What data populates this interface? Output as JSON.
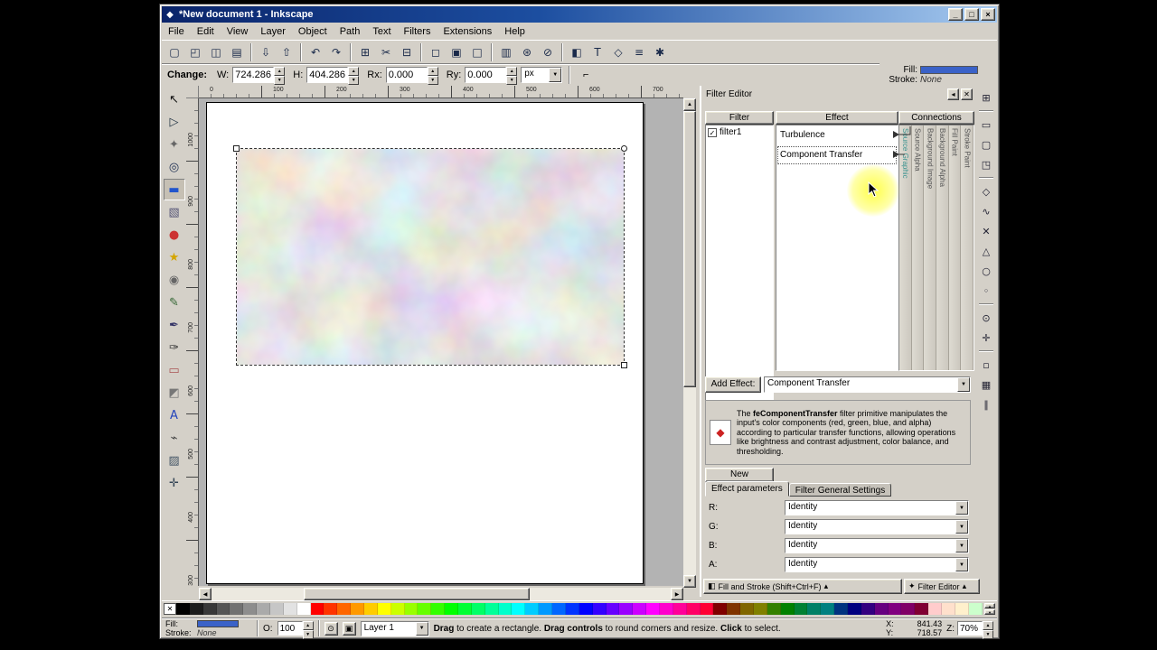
{
  "window": {
    "title": "*New document 1 - Inkscape"
  },
  "icons": {
    "window_logo": "◆",
    "window_minimize": "_",
    "window_maximize": "□",
    "window_close": "×",
    "dropdown_arrow": "▼",
    "spin_up": "▲",
    "spin_down": "▼",
    "scroll_left": "◀",
    "scroll_right": "▶",
    "scroll_up": "▲",
    "scroll_down": "▼",
    "collapse_arrow": "▴",
    "close": "✕",
    "dock_arrow": "◂",
    "check": "✓",
    "none_swatch_x": "✕",
    "corner_tool": "⌐",
    "eye": "⊙",
    "lock": "▣",
    "fill_stroke_bar_icon": "◧",
    "filter_bar_icon": "✦",
    "description_icon": "◆"
  },
  "menu": {
    "items": [
      "File",
      "Edit",
      "View",
      "Layer",
      "Object",
      "Path",
      "Text",
      "Filters",
      "Extensions",
      "Help"
    ]
  },
  "command_toolbar": {
    "buttons": [
      {
        "name": "new-document-button",
        "glyph": "▢"
      },
      {
        "name": "open-document-button",
        "glyph": "◰"
      },
      {
        "name": "save-document-button",
        "glyph": "◫"
      },
      {
        "name": "print-button",
        "glyph": "▤"
      },
      {
        "name": "separator"
      },
      {
        "name": "import-button",
        "glyph": "⇩"
      },
      {
        "name": "export-button",
        "glyph": "⇧"
      },
      {
        "name": "separator"
      },
      {
        "name": "undo-button",
        "glyph": "↶"
      },
      {
        "name": "redo-button",
        "glyph": "↷"
      },
      {
        "name": "separator"
      },
      {
        "name": "copy-button",
        "glyph": "⊞"
      },
      {
        "name": "cut-button",
        "glyph": "✂"
      },
      {
        "name": "paste-button",
        "glyph": "⊟"
      },
      {
        "name": "separator"
      },
      {
        "name": "zoom-selection-button",
        "glyph": "◻"
      },
      {
        "name": "zoom-drawing-button",
        "glyph": "▣"
      },
      {
        "name": "zoom-page-button",
        "glyph": "□"
      },
      {
        "name": "separator"
      },
      {
        "name": "duplicate-button",
        "glyph": "▥"
      },
      {
        "name": "clone-button",
        "glyph": "⊛"
      },
      {
        "name": "unlink-clone-button",
        "glyph": "⊘"
      },
      {
        "name": "separator"
      },
      {
        "name": "fill-stroke-dialog-button",
        "glyph": "◧"
      },
      {
        "name": "text-dialog-button",
        "glyph": "T"
      },
      {
        "name": "xml-editor-button",
        "glyph": "◇"
      },
      {
        "name": "align-dialog-button",
        "glyph": "≡"
      },
      {
        "name": "preferences-button",
        "glyph": "✱"
      }
    ]
  },
  "tool_options": {
    "context_label": "Change:",
    "fields": [
      {
        "label": "W:",
        "value": "724.286"
      },
      {
        "label": "H:",
        "value": "404.286"
      },
      {
        "label": "Rx:",
        "value": "0.000"
      },
      {
        "label": "Ry:",
        "value": "0.000"
      }
    ],
    "unit": "px"
  },
  "fill_indicator": {
    "fill_label": "Fill:",
    "stroke_label": "Stroke:",
    "stroke_value": "None",
    "fill_color": "#3a62c8"
  },
  "toolbox": {
    "tools": [
      {
        "name": "selector-tool",
        "glyph": "↖",
        "color": "#111111"
      },
      {
        "name": "node-tool",
        "glyph": "▷",
        "color": "#223344"
      },
      {
        "name": "tweak-tool",
        "glyph": "✦",
        "color": "#666666"
      },
      {
        "name": "zoom-tool",
        "glyph": "◎",
        "color": "#223355"
      },
      {
        "name": "rectangle-tool",
        "glyph": "▬",
        "color": "#2255cc",
        "active": true
      },
      {
        "name": "box3d-tool",
        "glyph": "▧",
        "color": "#555577"
      },
      {
        "name": "ellipse-tool",
        "glyph": "●",
        "color": "#cc3333"
      },
      {
        "name": "star-tool",
        "glyph": "★",
        "color": "#d4a500"
      },
      {
        "name": "spiral-tool",
        "glyph": "◉",
        "color": "#666666"
      },
      {
        "name": "pencil-tool",
        "glyph": "✎",
        "color": "#336633"
      },
      {
        "name": "pen-tool",
        "glyph": "✒",
        "color": "#333366"
      },
      {
        "name": "calligraphy-tool",
        "glyph": "✑",
        "color": "#333333"
      },
      {
        "name": "eraser-tool",
        "glyph": "▭",
        "color": "#aa5555"
      },
      {
        "name": "paint-bucket-tool",
        "glyph": "◩",
        "color": "#777777"
      },
      {
        "name": "text-tool",
        "glyph": "A",
        "color": "#2244bb"
      },
      {
        "name": "connector-tool",
        "glyph": "⌁",
        "color": "#444444"
      },
      {
        "name": "gradient-tool",
        "glyph": "▨",
        "color": "#445566"
      },
      {
        "name": "dropper-tool",
        "glyph": "✛",
        "color": "#334455"
      }
    ]
  },
  "snap_toolbar": {
    "buttons": [
      {
        "name": "snap-toggle-button",
        "glyph": "⊞"
      },
      {
        "name": "separator"
      },
      {
        "name": "snap-bbox-button",
        "glyph": "▭"
      },
      {
        "name": "snap-bbox-edges-button",
        "glyph": "▢"
      },
      {
        "name": "snap-bbox-corners-button",
        "glyph": "◳"
      },
      {
        "name": "separator"
      },
      {
        "name": "snap-nodes-button",
        "glyph": "◇"
      },
      {
        "name": "snap-paths-button",
        "glyph": "∿"
      },
      {
        "name": "snap-path-intersections-button",
        "glyph": "✕"
      },
      {
        "name": "snap-cusp-nodes-button",
        "glyph": "△"
      },
      {
        "name": "snap-smooth-nodes-button",
        "glyph": "○"
      },
      {
        "name": "snap-midpoints-button",
        "glyph": "◦"
      },
      {
        "name": "separator"
      },
      {
        "name": "snap-object-centers-button",
        "glyph": "⊙"
      },
      {
        "name": "snap-rotation-centers-button",
        "glyph": "✛"
      },
      {
        "name": "separator"
      },
      {
        "name": "snap-page-border-button",
        "glyph": "▫"
      },
      {
        "name": "snap-grid-button",
        "glyph": "▦"
      },
      {
        "name": "snap-guides-button",
        "glyph": "∥"
      }
    ]
  },
  "rulers": {
    "h_labels": [
      "0",
      "100",
      "200",
      "300",
      "400",
      "500",
      "600",
      "700"
    ],
    "v_labels": [
      "1000",
      "900",
      "800",
      "700",
      "600",
      "500",
      "400",
      "300"
    ]
  },
  "filter_editor": {
    "title": "Filter Editor",
    "filter_column_header": "Filter",
    "effect_column_header": "Effect",
    "connections_column_header": "Connections",
    "filters": [
      {
        "name": "filter1",
        "checked": true
      }
    ],
    "effects": [
      "Turbulence",
      "Component Transfer"
    ],
    "connection_labels": [
      "Source Graphic",
      "Source Alpha",
      "Background Image",
      "Background Alpha",
      "Fill Paint",
      "Stroke Paint"
    ],
    "add_effect_label": "Add Effect:",
    "add_effect_value": "Component Transfer",
    "description": {
      "prefix": "The ",
      "keyword": "feComponentTransfer",
      "rest": " filter primitive manipulates the input's color components (red, green, blue, and alpha) according to particular transfer functions, allowing operations like brightness and contrast adjustment, color balance, and thresholding."
    },
    "new_button": "New",
    "tabs": [
      "Effect parameters",
      "Filter General Settings"
    ],
    "params": [
      {
        "label": "R:",
        "value": "Identity"
      },
      {
        "label": "G:",
        "value": "Identity"
      },
      {
        "label": "B:",
        "value": "Identity"
      },
      {
        "label": "A:",
        "value": "Identity"
      }
    ],
    "bottom_bars": [
      "Fill and Stroke (Shift+Ctrl+F)",
      "Filter Editor"
    ]
  },
  "palette": {
    "colors": [
      "#000000",
      "#1c1c1c",
      "#383838",
      "#555555",
      "#717171",
      "#8d8d8d",
      "#aaaaaa",
      "#c6c6c6",
      "#e2e2e2",
      "#ffffff",
      "#ff0000",
      "#ff3300",
      "#ff6600",
      "#ff9900",
      "#ffcc00",
      "#ffff00",
      "#ccff00",
      "#99ff00",
      "#66ff00",
      "#33ff00",
      "#00ff00",
      "#00ff33",
      "#00ff66",
      "#00ff99",
      "#00ffcc",
      "#00ffff",
      "#00ccff",
      "#0099ff",
      "#0066ff",
      "#0033ff",
      "#0000ff",
      "#3300ff",
      "#6600ff",
      "#9900ff",
      "#cc00ff",
      "#ff00ff",
      "#ff00cc",
      "#ff0099",
      "#ff0066",
      "#ff0033",
      "#800000",
      "#803300",
      "#806600",
      "#808000",
      "#338000",
      "#008000",
      "#008033",
      "#008066",
      "#008080",
      "#003380",
      "#000080",
      "#330080",
      "#660080",
      "#800080",
      "#800066",
      "#800033",
      "#ffcccc",
      "#ffe0cc",
      "#fff0cc",
      "#ccffcc"
    ]
  },
  "status_bar": {
    "fill_label": "Fill:",
    "stroke_label": "Stroke:",
    "stroke_value": "None",
    "fill_color": "#3a62c8",
    "opacity_label": "O:",
    "opacity_value": "100",
    "layer_name": "Layer 1",
    "message": {
      "b1": "Drag",
      "t1": " to create a rectangle. ",
      "b2": "Drag controls",
      "t2": " to round corners and resize. ",
      "b3": "Click",
      "t3": " to select."
    },
    "x_label": "X:",
    "x_value": "841.43",
    "y_label": "Y:",
    "y_value": "718.57",
    "z_label": "Z:",
    "z_value": "70%"
  }
}
